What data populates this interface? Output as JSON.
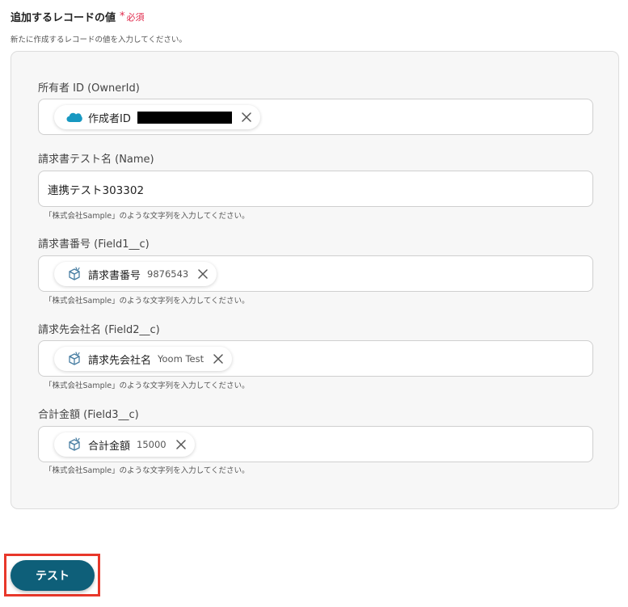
{
  "section": {
    "title": "追加するレコードの値",
    "required_label": "必須",
    "required_mark": "*",
    "description": "新たに作成するレコードの値を入力してください。"
  },
  "fields": [
    {
      "label": "所有者 ID (OwnerId)",
      "chip": {
        "icon": "salesforce-cloud-icon",
        "label": "作成者ID"
      }
    },
    {
      "label": "請求書テスト名 (Name)",
      "value": "連携テスト303302",
      "hint": "「株式会社Sample」のような文字列を入力してください。"
    },
    {
      "label": "請求書番号 (Field1__c)",
      "chip": {
        "icon": "box-data-icon",
        "label": "請求書番号",
        "value": "9876543"
      },
      "hint": "「株式会社Sample」のような文字列を入力してください。"
    },
    {
      "label": "請求先会社名 (Field2__c)",
      "chip": {
        "icon": "box-data-icon",
        "label": "請求先会社名",
        "value": "Yoom Test"
      },
      "hint": "「株式会社Sample」のような文字列を入力してください。"
    },
    {
      "label": "合計金額 (Field3__c)",
      "chip": {
        "icon": "box-data-icon",
        "label": "合計金額",
        "value": "15000"
      },
      "hint": "「株式会社Sample」のような文字列を入力してください。"
    }
  ],
  "test_button": {
    "label": "テスト"
  },
  "colors": {
    "accent_button": "#0e5f79",
    "highlight_outline": "#e8372a",
    "required": "#e0284a",
    "salesforce": "#1798c1",
    "data_icon": "#4a7fa3"
  }
}
